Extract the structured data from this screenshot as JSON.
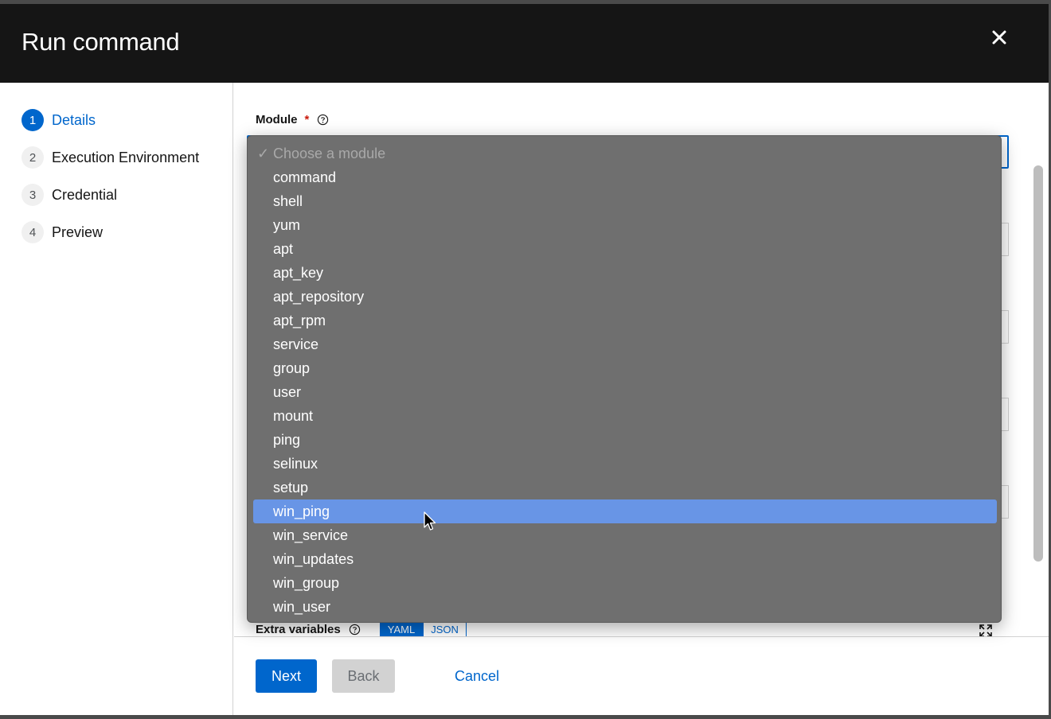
{
  "modal": {
    "title": "Run command",
    "close_icon": "close-icon"
  },
  "wizard": {
    "steps": [
      {
        "number": "1",
        "label": "Details",
        "active": true
      },
      {
        "number": "2",
        "label": "Execution Environment",
        "active": false
      },
      {
        "number": "3",
        "label": "Credential",
        "active": false
      },
      {
        "number": "4",
        "label": "Preview",
        "active": false
      }
    ]
  },
  "form": {
    "module_label": "Module",
    "required_marker": "*",
    "help_icon": "help-icon",
    "extra_variables_label": "Extra variables",
    "toggle_yaml": "YAML",
    "toggle_json": "JSON",
    "expand_icon": "expand-icon"
  },
  "dropdown": {
    "placeholder_check": "✓",
    "placeholder": "Choose a module",
    "options": [
      "command",
      "shell",
      "yum",
      "apt",
      "apt_key",
      "apt_repository",
      "apt_rpm",
      "service",
      "group",
      "user",
      "mount",
      "ping",
      "selinux",
      "setup",
      "win_ping",
      "win_service",
      "win_updates",
      "win_group",
      "win_user"
    ],
    "highlighted": "win_ping"
  },
  "footer": {
    "next_label": "Next",
    "back_label": "Back",
    "cancel_label": "Cancel"
  },
  "colors": {
    "primary": "#0066cc",
    "header_bg": "#151515",
    "dropdown_bg": "#6f6f6f",
    "highlight": "#6895e6",
    "required": "#c9190b"
  }
}
